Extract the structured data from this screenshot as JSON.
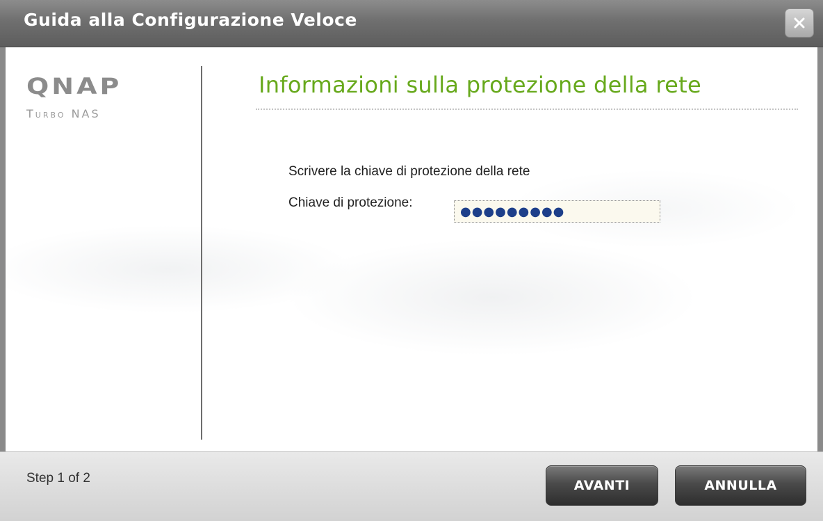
{
  "window": {
    "title": "Guida alla Configurazione Veloce",
    "close_label": "close"
  },
  "logo": {
    "brand": "QNAP",
    "product": "Turbo NAS"
  },
  "main": {
    "heading": "Informazioni sulla protezione della rete",
    "instruction": "Scrivere la chiave di protezione della rete",
    "key_label": "Chiave di protezione:",
    "key_value_masked": "●●●●●●●●●"
  },
  "footer": {
    "step_text": "Step 1 of 2",
    "next_label": "AVANTI",
    "cancel_label": "ANNULLA"
  },
  "colors": {
    "heading_green": "#67a91c",
    "titlebar_gray": "#6f6f6f",
    "button_dark": "#3a3a3a"
  },
  "icons": {
    "close": "close-icon"
  }
}
